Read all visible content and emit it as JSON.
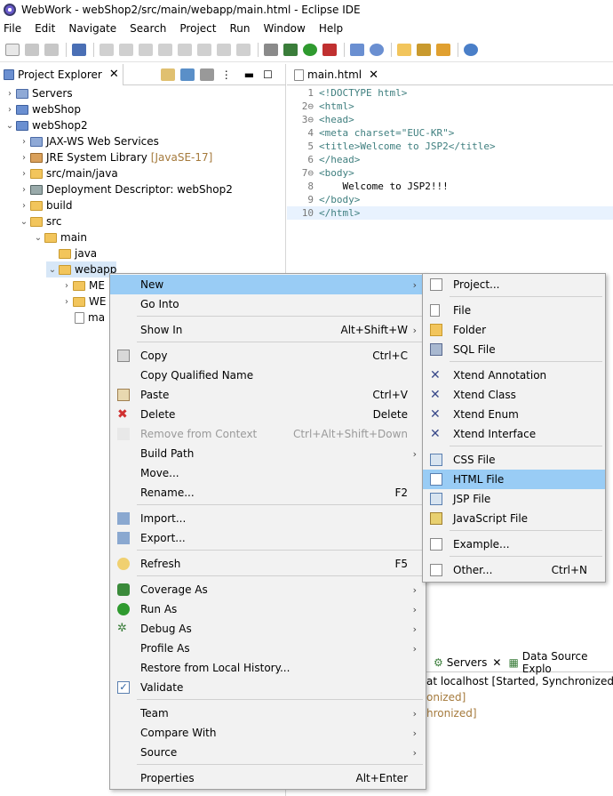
{
  "window": {
    "title": "WebWork - webShop2/src/main/webapp/main.html - Eclipse IDE"
  },
  "menubar": [
    "File",
    "Edit",
    "Navigate",
    "Search",
    "Project",
    "Run",
    "Window",
    "Help"
  ],
  "explorer": {
    "tab_label": "Project Explorer",
    "tree": [
      {
        "label": "Servers",
        "extra": ""
      },
      {
        "label": "webShop",
        "extra": ""
      },
      {
        "label": "webShop2",
        "extra": ""
      },
      {
        "label": "JAX-WS Web Services",
        "extra": ""
      },
      {
        "label": "JRE System Library",
        "extra": "[JavaSE-17]"
      },
      {
        "label": "src/main/java",
        "extra": ""
      },
      {
        "label": "Deployment Descriptor: webShop2",
        "extra": ""
      },
      {
        "label": "build",
        "extra": ""
      },
      {
        "label": "src",
        "extra": ""
      },
      {
        "label": "main",
        "extra": ""
      },
      {
        "label": "java",
        "extra": ""
      },
      {
        "label": "webapp",
        "extra": ""
      },
      {
        "label": "ME",
        "extra": ""
      },
      {
        "label": "WE",
        "extra": ""
      },
      {
        "label": "ma",
        "extra": ""
      }
    ]
  },
  "editor": {
    "tab_label": "main.html",
    "lines": [
      {
        "n": "1",
        "text": "<!DOCTYPE html>"
      },
      {
        "n": "2⊖",
        "text": "<html>"
      },
      {
        "n": "3⊖",
        "text": "<head>"
      },
      {
        "n": "4",
        "text": "<meta charset=\"EUC-KR\">"
      },
      {
        "n": "5",
        "text": "<title>Welcome to JSP2</title>"
      },
      {
        "n": "6",
        "text": "</head>"
      },
      {
        "n": "7⊖",
        "text": "<body>"
      },
      {
        "n": "8",
        "text": "    Welcome to JSP2!!!"
      },
      {
        "n": "9",
        "text": "</body>"
      },
      {
        "n": "10",
        "text": "</html>"
      }
    ]
  },
  "servers_panel": {
    "tab_servers": "Servers",
    "tab_datasource": "Data Source Explo",
    "rows": [
      "at localhost  [Started, Synchronized]",
      "onized]",
      "hronized]"
    ]
  },
  "context_menu": {
    "items": [
      {
        "label": "New",
        "shortcut": "",
        "submenu": true
      },
      {
        "label": "Go Into",
        "shortcut": "",
        "submenu": false
      },
      {
        "label": "Show In",
        "shortcut": "Alt+Shift+W",
        "submenu": true
      },
      {
        "label": "Copy",
        "shortcut": "Ctrl+C",
        "submenu": false
      },
      {
        "label": "Copy Qualified Name",
        "shortcut": "",
        "submenu": false
      },
      {
        "label": "Paste",
        "shortcut": "Ctrl+V",
        "submenu": false
      },
      {
        "label": "Delete",
        "shortcut": "Delete",
        "submenu": false
      },
      {
        "label": "Remove from Context",
        "shortcut": "Ctrl+Alt+Shift+Down",
        "submenu": false
      },
      {
        "label": "Build Path",
        "shortcut": "",
        "submenu": true
      },
      {
        "label": "Move...",
        "shortcut": "",
        "submenu": false
      },
      {
        "label": "Rename...",
        "shortcut": "F2",
        "submenu": false
      },
      {
        "label": "Import...",
        "shortcut": "",
        "submenu": false
      },
      {
        "label": "Export...",
        "shortcut": "",
        "submenu": false
      },
      {
        "label": "Refresh",
        "shortcut": "F5",
        "submenu": false
      },
      {
        "label": "Coverage As",
        "shortcut": "",
        "submenu": true
      },
      {
        "label": "Run As",
        "shortcut": "",
        "submenu": true
      },
      {
        "label": "Debug As",
        "shortcut": "",
        "submenu": true
      },
      {
        "label": "Profile As",
        "shortcut": "",
        "submenu": true
      },
      {
        "label": "Restore from Local History...",
        "shortcut": "",
        "submenu": false
      },
      {
        "label": "Validate",
        "shortcut": "",
        "submenu": false
      },
      {
        "label": "Team",
        "shortcut": "",
        "submenu": true
      },
      {
        "label": "Compare With",
        "shortcut": "",
        "submenu": true
      },
      {
        "label": "Source",
        "shortcut": "",
        "submenu": true
      },
      {
        "label": "Properties",
        "shortcut": "Alt+Enter",
        "submenu": false
      }
    ]
  },
  "new_submenu": {
    "items": [
      {
        "label": "Project...",
        "shortcut": ""
      },
      {
        "label": "File",
        "shortcut": ""
      },
      {
        "label": "Folder",
        "shortcut": ""
      },
      {
        "label": "SQL File",
        "shortcut": ""
      },
      {
        "label": "Xtend Annotation",
        "shortcut": ""
      },
      {
        "label": "Xtend Class",
        "shortcut": ""
      },
      {
        "label": "Xtend Enum",
        "shortcut": ""
      },
      {
        "label": "Xtend Interface",
        "shortcut": ""
      },
      {
        "label": "CSS File",
        "shortcut": ""
      },
      {
        "label": "HTML File",
        "shortcut": ""
      },
      {
        "label": "JSP File",
        "shortcut": ""
      },
      {
        "label": "JavaScript File",
        "shortcut": ""
      },
      {
        "label": "Example...",
        "shortcut": ""
      },
      {
        "label": "Other...",
        "shortcut": "Ctrl+N"
      }
    ]
  },
  "colors": {
    "highlight": "#99ccf5",
    "menu_bg": "#f2f2f2",
    "tag": "#3f7f7f",
    "string": "#2a00ff"
  }
}
